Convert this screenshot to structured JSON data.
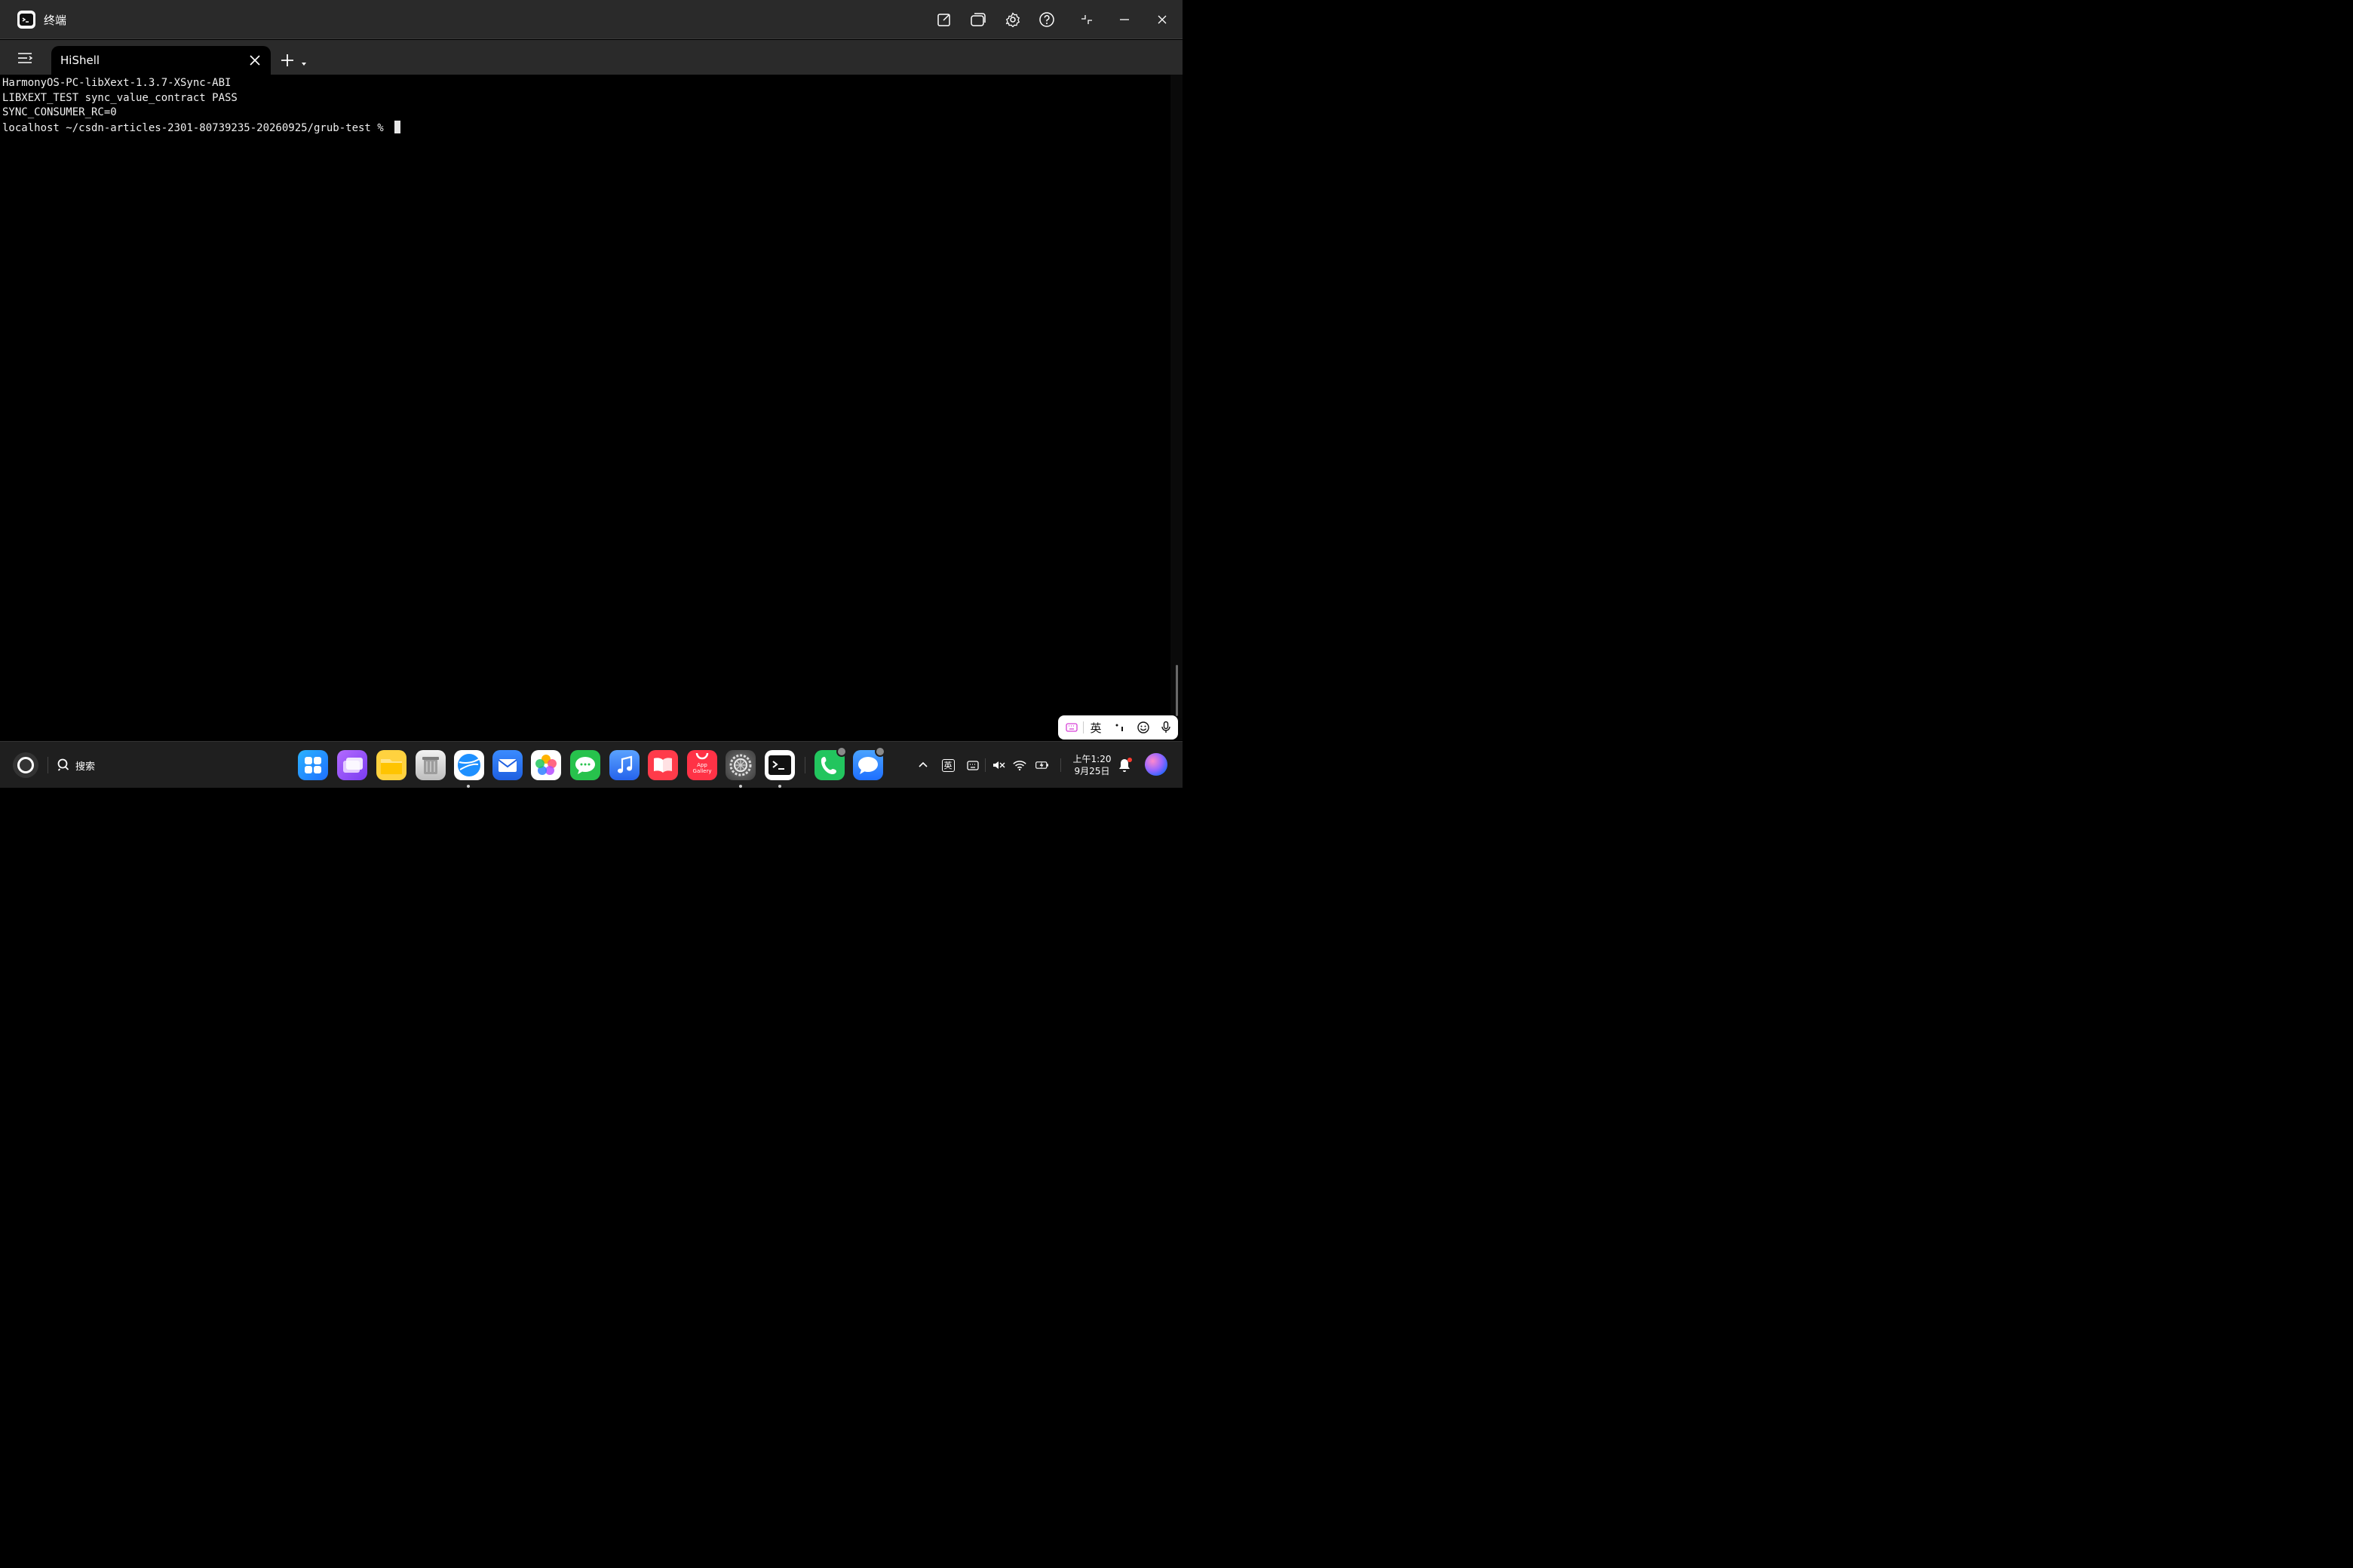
{
  "window": {
    "title": "终端",
    "controls": [
      "edit-icon",
      "window-icon",
      "gear-icon",
      "help-icon",
      "restore-icon",
      "minimize-icon",
      "close-icon"
    ]
  },
  "tabs": {
    "items": [
      {
        "label": "HiShell",
        "active": true
      }
    ]
  },
  "terminal": {
    "lines": [
      "HarmonyOS-PC-libXext-1.3.7-XSync-ABI",
      "LIBXEXT_TEST sync_value_contract PASS",
      "SYNC_CONSUMER_RC=0",
      "localhost ~/csdn-articles-2301-80739235-20260925/grub-test % "
    ]
  },
  "ime": {
    "mode_label": "英",
    "items": [
      "keyboard-icon",
      "mode",
      "punctuation-icon",
      "emoji-icon",
      "microphone-icon"
    ]
  },
  "taskbar": {
    "search_label": "搜索",
    "apps": [
      {
        "name": "app-center",
        "running": false
      },
      {
        "name": "multi-window",
        "running": false
      },
      {
        "name": "files",
        "running": false
      },
      {
        "name": "trash",
        "running": false
      },
      {
        "name": "browser",
        "running": true
      },
      {
        "name": "mail",
        "running": false
      },
      {
        "name": "photos",
        "running": false
      },
      {
        "name": "messages",
        "running": false
      },
      {
        "name": "music",
        "running": false
      },
      {
        "name": "books",
        "running": false
      },
      {
        "name": "app-gallery",
        "running": false,
        "label": "App Gallery"
      },
      {
        "name": "settings",
        "running": true
      },
      {
        "name": "terminal",
        "running": true
      },
      {
        "name": "phone",
        "running": false
      },
      {
        "name": "chat",
        "running": false
      }
    ],
    "tray": {
      "ime_label": "英",
      "time": "上午1:20",
      "date": "9月25日"
    }
  },
  "colors": {
    "titlebar": "#2a2a2a",
    "terminal_bg": "#000000",
    "terminal_fg": "#f0f0f0",
    "taskbar": "#1f1f1f",
    "accent": "#1e6fff"
  }
}
